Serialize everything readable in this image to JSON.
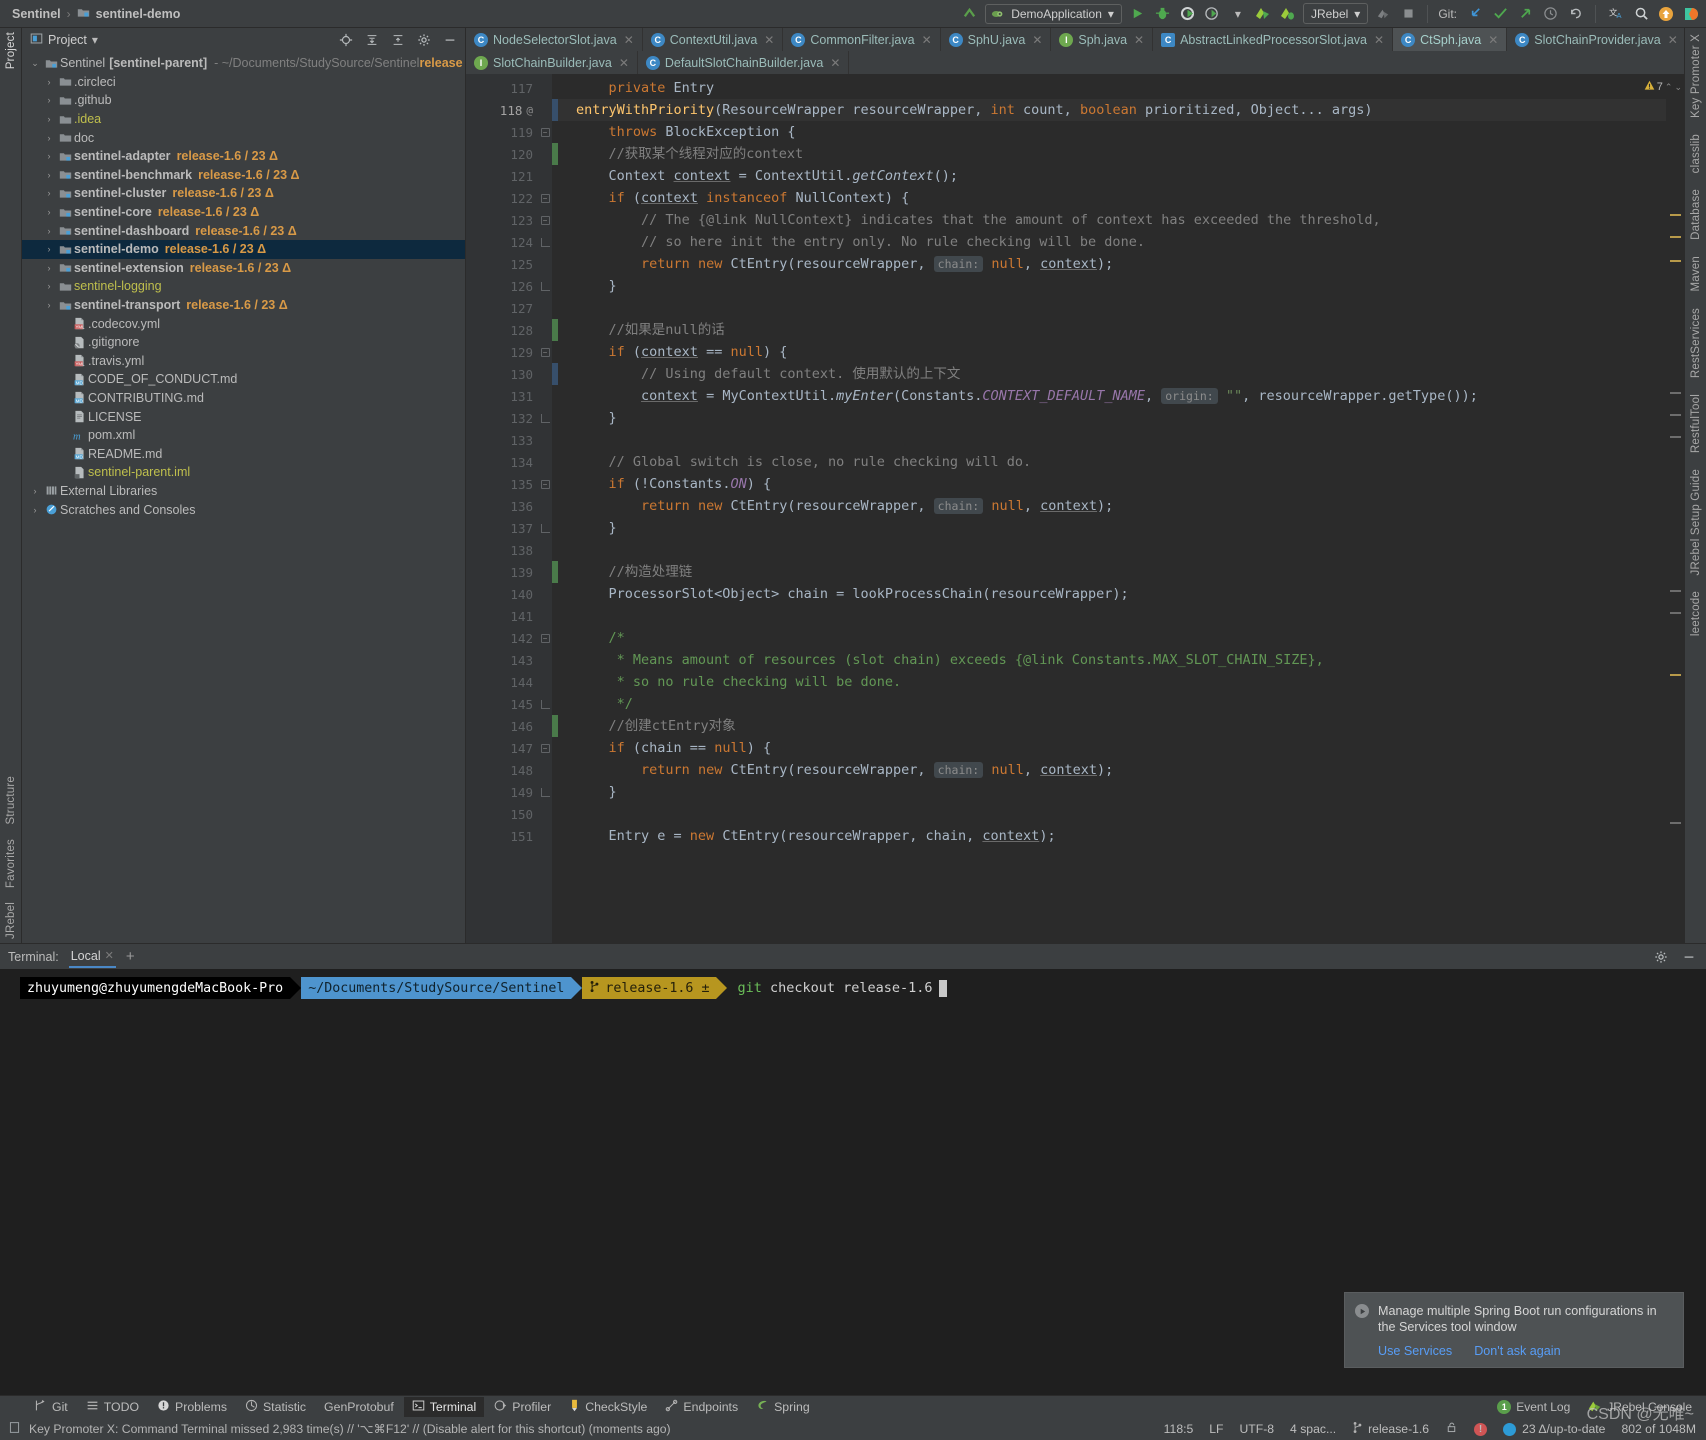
{
  "breadcrumb": {
    "root": "Sentinel",
    "sep": "›",
    "current": "sentinel-demo"
  },
  "toolbar": {
    "run_config": "DemoApplication",
    "jrebel_label": "JRebel",
    "git_label": "Git:",
    "icons": [
      "build-icon",
      "run-icon",
      "debug-icon",
      "run-coverage-icon",
      "profiler-icon",
      "jrebel-run-icon",
      "jrebel-debug-icon"
    ]
  },
  "project_panel": {
    "title": "Project",
    "tools": [
      "locate-icon",
      "expand-all-icon",
      "collapse-all-icon",
      "settings-icon",
      "hide-icon"
    ],
    "root": {
      "label": "Sentinel",
      "module": "[sentinel-parent]",
      "path": "- ~/Documents/StudySource/Sentinel",
      "branch": "release"
    },
    "items": [
      {
        "label": ".circleci",
        "type": "folder",
        "indent": 1,
        "arrow": true,
        "branch": ""
      },
      {
        "label": ".github",
        "type": "folder",
        "indent": 1,
        "arrow": true,
        "branch": ""
      },
      {
        "label": ".idea",
        "type": "folder-excluded",
        "indent": 1,
        "arrow": true,
        "branch": ""
      },
      {
        "label": "doc",
        "type": "folder",
        "indent": 1,
        "arrow": true,
        "branch": ""
      },
      {
        "label": "sentinel-adapter",
        "type": "module",
        "indent": 1,
        "arrow": true,
        "branch": "release-1.6 / 23 Δ"
      },
      {
        "label": "sentinel-benchmark",
        "type": "module",
        "indent": 1,
        "arrow": true,
        "branch": "release-1.6 / 23 Δ"
      },
      {
        "label": "sentinel-cluster",
        "type": "module",
        "indent": 1,
        "arrow": true,
        "branch": "release-1.6 / 23 Δ"
      },
      {
        "label": "sentinel-core",
        "type": "module",
        "indent": 1,
        "arrow": true,
        "branch": "release-1.6 / 23 Δ"
      },
      {
        "label": "sentinel-dashboard",
        "type": "module",
        "indent": 1,
        "arrow": true,
        "branch": "release-1.6 / 23 Δ"
      },
      {
        "label": "sentinel-demo",
        "type": "module",
        "indent": 1,
        "arrow": true,
        "branch": "release-1.6 / 23 Δ",
        "selected": true
      },
      {
        "label": "sentinel-extension",
        "type": "module",
        "indent": 1,
        "arrow": true,
        "branch": "release-1.6 / 23 Δ"
      },
      {
        "label": "sentinel-logging",
        "type": "folder-excluded",
        "indent": 1,
        "arrow": true,
        "branch": ""
      },
      {
        "label": "sentinel-transport",
        "type": "module",
        "indent": 1,
        "arrow": true,
        "branch": "release-1.6 / 23 Δ"
      },
      {
        "label": ".codecov.yml",
        "type": "yml",
        "indent": 2,
        "arrow": false,
        "branch": ""
      },
      {
        "label": ".gitignore",
        "type": "ignore",
        "indent": 2,
        "arrow": false,
        "branch": ""
      },
      {
        "label": ".travis.yml",
        "type": "yml",
        "indent": 2,
        "arrow": false,
        "branch": ""
      },
      {
        "label": "CODE_OF_CONDUCT.md",
        "type": "md",
        "indent": 2,
        "arrow": false,
        "branch": ""
      },
      {
        "label": "CONTRIBUTING.md",
        "type": "md",
        "indent": 2,
        "arrow": false,
        "branch": ""
      },
      {
        "label": "LICENSE",
        "type": "file",
        "indent": 2,
        "arrow": false,
        "branch": ""
      },
      {
        "label": "pom.xml",
        "type": "maven",
        "indent": 2,
        "arrow": false,
        "branch": ""
      },
      {
        "label": "README.md",
        "type": "md",
        "indent": 2,
        "arrow": false,
        "branch": ""
      },
      {
        "label": "sentinel-parent.iml",
        "type": "iml",
        "indent": 2,
        "arrow": false,
        "branch": ""
      }
    ],
    "bottom_items": [
      {
        "label": "External Libraries",
        "type": "libs",
        "arrow": true
      },
      {
        "label": "Scratches and Consoles",
        "type": "scratches",
        "arrow": true
      }
    ]
  },
  "editor": {
    "tabs_row1": [
      {
        "label": "NodeSelectorSlot.java",
        "icon": "class-icon",
        "active": false
      },
      {
        "label": "ContextUtil.java",
        "icon": "class-icon",
        "active": false
      },
      {
        "label": "CommonFilter.java",
        "icon": "class-icon",
        "active": false
      },
      {
        "label": "SphU.java",
        "icon": "class-icon",
        "active": false
      },
      {
        "label": "Sph.java",
        "icon": "interface-icon",
        "active": false
      },
      {
        "label": "AbstractLinkedProcessorSlot.java",
        "icon": "abstract-class-icon",
        "active": false
      },
      {
        "label": "CtSph.java",
        "icon": "class-icon",
        "active": true
      },
      {
        "label": "SlotChainProvider.java",
        "icon": "class-icon",
        "active": false
      }
    ],
    "tabs_row2": [
      {
        "label": "SlotChainBuilder.java",
        "icon": "interface-icon",
        "active": false
      },
      {
        "label": "DefaultSlotChainBuilder.java",
        "icon": "class-icon",
        "active": false
      }
    ],
    "warning_count": "7",
    "lines": [
      {
        "n": 117,
        "at": false,
        "fold": "",
        "change": "",
        "cur": false,
        "html": "    <span class=\"kw\">private</span> Entry"
      },
      {
        "n": 118,
        "at": true,
        "fold": "",
        "change": "mod",
        "cur": true,
        "html": "<span class=\"mth\">entryWithPriority</span>(ResourceWrapper resourceWrapper, <span class=\"kw\">int</span> count, <span class=\"kw\">boolean</span> prioritized, Object... args)"
      },
      {
        "n": 119,
        "at": false,
        "fold": "open",
        "change": "",
        "cur": false,
        "html": "    <span class=\"kw\">throws</span> BlockException {"
      },
      {
        "n": 120,
        "at": false,
        "fold": "",
        "change": "added",
        "cur": false,
        "html": "    <span class=\"cmt\">//获取某个线程对应的context</span>"
      },
      {
        "n": 121,
        "at": false,
        "fold": "",
        "change": "",
        "cur": false,
        "html": "    Context <span class=\"und\">context</span> = ContextUtil.<span class=\"mi\">getContext</span>();"
      },
      {
        "n": 122,
        "at": false,
        "fold": "open",
        "change": "",
        "cur": false,
        "html": "    <span class=\"kw\">if</span> (<span class=\"und\">context</span> <span class=\"kw\">instanceof</span> NullContext) {"
      },
      {
        "n": 123,
        "at": false,
        "fold": "open",
        "change": "",
        "cur": false,
        "html": "        <span class=\"cmt\">// The {@link NullContext} indicates that the amount of context has exceeded the threshold,</span>"
      },
      {
        "n": 124,
        "at": false,
        "fold": "end",
        "change": "",
        "cur": false,
        "html": "        <span class=\"cmt\">// so here init the entry only. No rule checking will be done.</span>"
      },
      {
        "n": 125,
        "at": false,
        "fold": "",
        "change": "",
        "cur": false,
        "html": "        <span class=\"kw\">return</span> <span class=\"kw\">new</span> CtEntry(resourceWrapper, <span class=\"hint\">chain:</span> <span class=\"kw\">null</span>, <span class=\"und\">context</span>);"
      },
      {
        "n": 126,
        "at": false,
        "fold": "end",
        "change": "",
        "cur": false,
        "html": "    }"
      },
      {
        "n": 127,
        "at": false,
        "fold": "",
        "change": "",
        "cur": false,
        "html": ""
      },
      {
        "n": 128,
        "at": false,
        "fold": "",
        "change": "added",
        "cur": false,
        "html": "    <span class=\"cmt\">//如果是null的话</span>"
      },
      {
        "n": 129,
        "at": false,
        "fold": "open",
        "change": "",
        "cur": false,
        "html": "    <span class=\"kw\">if</span> (<span class=\"und\">context</span> == <span class=\"kw\">null</span>) {"
      },
      {
        "n": 130,
        "at": false,
        "fold": "",
        "change": "mod",
        "cur": false,
        "html": "        <span class=\"cmt\">// Using default context. 使用默认的上下文</span>"
      },
      {
        "n": 131,
        "at": false,
        "fold": "",
        "change": "",
        "cur": false,
        "html": "        <span class=\"und\">context</span> = MyContextUtil.<span class=\"mi\">myEnter</span>(Constants.<span class=\"stat\">CONTEXT_DEFAULT_NAME</span>, <span class=\"hint\">origin:</span> <span class=\"str\">\"\"</span>, resourceWrapper.getType());"
      },
      {
        "n": 132,
        "at": false,
        "fold": "end",
        "change": "",
        "cur": false,
        "html": "    }"
      },
      {
        "n": 133,
        "at": false,
        "fold": "",
        "change": "",
        "cur": false,
        "html": ""
      },
      {
        "n": 134,
        "at": false,
        "fold": "",
        "change": "",
        "cur": false,
        "html": "    <span class=\"cmt\">// Global switch is close, no rule checking will do.</span>"
      },
      {
        "n": 135,
        "at": false,
        "fold": "open",
        "change": "",
        "cur": false,
        "html": "    <span class=\"kw\">if</span> (!Constants.<span class=\"stat\">ON</span>) {"
      },
      {
        "n": 136,
        "at": false,
        "fold": "",
        "change": "",
        "cur": false,
        "html": "        <span class=\"kw\">return</span> <span class=\"kw\">new</span> CtEntry(resourceWrapper, <span class=\"hint\">chain:</span> <span class=\"kw\">null</span>, <span class=\"und\">context</span>);"
      },
      {
        "n": 137,
        "at": false,
        "fold": "end",
        "change": "",
        "cur": false,
        "html": "    }"
      },
      {
        "n": 138,
        "at": false,
        "fold": "",
        "change": "",
        "cur": false,
        "html": ""
      },
      {
        "n": 139,
        "at": false,
        "fold": "",
        "change": "added",
        "cur": false,
        "html": "    <span class=\"cmt\">//构造处理链</span>"
      },
      {
        "n": 140,
        "at": false,
        "fold": "",
        "change": "",
        "cur": false,
        "html": "    ProcessorSlot&lt;Object&gt; chain = lookProcessChain(resourceWrapper);"
      },
      {
        "n": 141,
        "at": false,
        "fold": "",
        "change": "",
        "cur": false,
        "html": ""
      },
      {
        "n": 142,
        "at": false,
        "fold": "open",
        "change": "",
        "cur": false,
        "html": "    <span class=\"cmt2\">/*</span>"
      },
      {
        "n": 143,
        "at": false,
        "fold": "",
        "change": "",
        "cur": false,
        "html": "     <span class=\"cmt2\">* Means amount of resources (slot chain) exceeds {@link Constants.MAX_SLOT_CHAIN_SIZE},</span>"
      },
      {
        "n": 144,
        "at": false,
        "fold": "",
        "change": "",
        "cur": false,
        "html": "     <span class=\"cmt2\">* so no rule checking will be done.</span>"
      },
      {
        "n": 145,
        "at": false,
        "fold": "end",
        "change": "",
        "cur": false,
        "html": "     <span class=\"cmt2\">*/</span>"
      },
      {
        "n": 146,
        "at": false,
        "fold": "",
        "change": "added",
        "cur": false,
        "html": "    <span class=\"cmt\">//创建ctEntry对象</span>"
      },
      {
        "n": 147,
        "at": false,
        "fold": "open",
        "change": "",
        "cur": false,
        "html": "    <span class=\"kw\">if</span> (chain == <span class=\"kw\">null</span>) {"
      },
      {
        "n": 148,
        "at": false,
        "fold": "",
        "change": "",
        "cur": false,
        "html": "        <span class=\"kw\">return</span> <span class=\"kw\">new</span> CtEntry(resourceWrapper, <span class=\"hint\">chain:</span> <span class=\"kw\">null</span>, <span class=\"und\">context</span>);"
      },
      {
        "n": 149,
        "at": false,
        "fold": "end",
        "change": "",
        "cur": false,
        "html": "    }"
      },
      {
        "n": 150,
        "at": false,
        "fold": "",
        "change": "",
        "cur": false,
        "html": ""
      },
      {
        "n": 151,
        "at": false,
        "fold": "",
        "change": "",
        "cur": false,
        "html": "    Entry e = <span class=\"kw\">new</span> CtEntry(resourceWrapper, chain, <span class=\"und\">context</span>);"
      }
    ]
  },
  "terminal": {
    "label": "Terminal:",
    "tab": "Local",
    "add": "+",
    "prompt_user": "zhuyumeng@zhuyumengdeMacBook-Pro",
    "prompt_path": "~/Documents/StudySource/Sentinel",
    "prompt_branch": "release-1.6 ±",
    "command_prefix": "git",
    "command_rest": " checkout release-1.6"
  },
  "notification": {
    "message": "Manage multiple Spring Boot run configurations in the Services tool window",
    "action_primary": "Use Services",
    "action_secondary": "Don't ask again"
  },
  "tool_window_bar": {
    "items": [
      {
        "label": "Git",
        "icon": "git-icon",
        "active": false
      },
      {
        "label": "TODO",
        "icon": "todo-icon",
        "active": false
      },
      {
        "label": "Problems",
        "icon": "problems-icon",
        "active": false
      },
      {
        "label": "Statistic",
        "icon": "statistic-icon",
        "active": false
      },
      {
        "label": "GenProtobuf",
        "icon": "protobuf-icon",
        "active": false
      },
      {
        "label": "Terminal",
        "icon": "terminal-icon",
        "active": true
      },
      {
        "label": "Profiler",
        "icon": "profiler-icon",
        "active": false
      },
      {
        "label": "CheckStyle",
        "icon": "checkstyle-icon",
        "active": false
      },
      {
        "label": "Endpoints",
        "icon": "endpoints-icon",
        "active": false
      },
      {
        "label": "Spring",
        "icon": "spring-icon",
        "active": false
      }
    ],
    "event_log": "Event Log",
    "event_log_count": "1",
    "jrebel_console": "JRebel Console"
  },
  "status_bar": {
    "message": "Key Promoter X: Command Terminal missed 2,983 time(s) // '⌥⌘F12' // (Disable alert for this shortcut) (moments ago)",
    "caret": "118:5",
    "line_sep": "LF",
    "encoding": "UTF-8",
    "indent": "4 spac...",
    "branch": "release-1.6",
    "jrebel_status": "23 Δ/up-to-date",
    "memory": "802 of 1048M",
    "watermark": "CSDN @无唯~"
  },
  "left_rail": {
    "top": [
      "Project"
    ],
    "bottom": [
      "Structure",
      "Favorites",
      "JRebel"
    ]
  },
  "right_rail": {
    "items": [
      "Key Promoter X",
      "classlib",
      "Database",
      "Maven",
      "RestServices",
      "RestfulTool",
      "JRebel Setup Guide",
      "leetcode"
    ]
  }
}
